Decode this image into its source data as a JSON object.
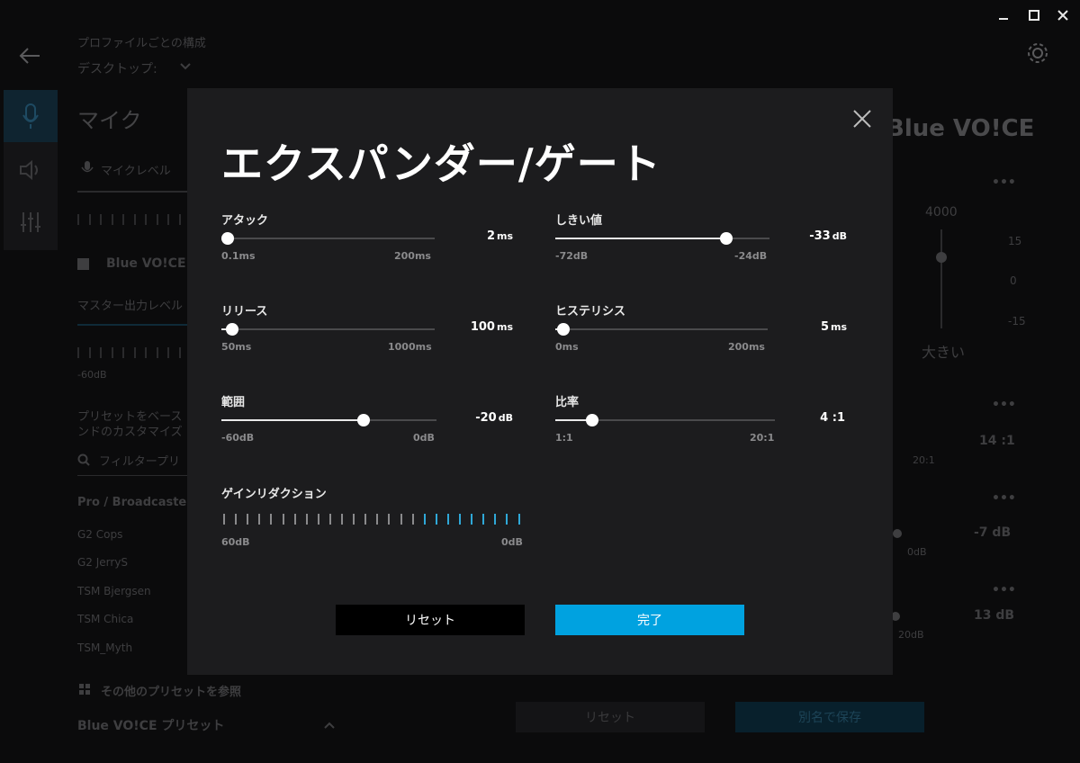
{
  "window": {
    "minimize_icon": "minimize-icon",
    "maximize_icon": "maximize-icon",
    "close_icon": "close-icon"
  },
  "background": {
    "header": {
      "title": "プロファイルごとの構成",
      "profile": "デスクトップ:"
    },
    "section_title": "マイク",
    "mic_level_tab": "マイクレベル",
    "blue_voice_logo": "Blue VO!CE",
    "blue_voice_label": "Blue VO!CE",
    "master_output": "マスター出力レベル",
    "meter_min": "-60dB",
    "preset_desc_line1": "プリセットをベース",
    "preset_desc_line2": "ンドのカスタマイズ",
    "filter_placeholder": "フィルタープリ",
    "preset_group": "Pro / Broadcaster",
    "presets": [
      "G2 Cops",
      "G2 JerryS",
      "TSM Bjergsen",
      "TSM Chica",
      "TSM_Myth"
    ],
    "browse_presets": "その他のプリセットを参照",
    "blue_presets": "Blue VO!CE プリセット",
    "eq_freq": "4000",
    "eq_db": [
      "15",
      "0",
      "-15"
    ],
    "eq_louder": "大きい",
    "right_values": [
      "14 :1",
      "-7 dB",
      "13 dB"
    ],
    "right_small": [
      "20:1",
      "0dB",
      "20dB"
    ],
    "reset_button": "リセット",
    "save_as_button": "別名で保存"
  },
  "modal": {
    "title": "エクスパンダー/ゲート",
    "sliders": [
      {
        "id": "attack",
        "label": "アタック",
        "value": "2",
        "unit": "ms",
        "min": "0.1ms",
        "max": "200ms",
        "position": 0.03
      },
      {
        "id": "threshold",
        "label": "しきい値",
        "value": "-33",
        "unit": "dB",
        "min": "-72dB",
        "max": "-24dB",
        "position": 0.8
      },
      {
        "id": "release",
        "label": "リリース",
        "value": "100",
        "unit": "ms",
        "min": "50ms",
        "max": "1000ms",
        "position": 0.05
      },
      {
        "id": "hysteresis",
        "label": "ヒステリシス",
        "value": "5",
        "unit": "ms",
        "min": "0ms",
        "max": "200ms",
        "position": 0.04
      },
      {
        "id": "range",
        "label": "範囲",
        "value": "-20",
        "unit": "dB",
        "min": "-60dB",
        "max": "0dB",
        "position": 0.66
      },
      {
        "id": "ratio",
        "label": "比率",
        "value": "4 :1",
        "unit": "",
        "min": "1:1",
        "max": "20:1",
        "position": 0.17
      }
    ],
    "gain_reduction": {
      "label": "ゲインリダクション",
      "min": "60dB",
      "max": "0dB",
      "tick_count": 26,
      "active_count": 9,
      "active_color": "#2fa8d8"
    },
    "reset_button": "リセット",
    "done_button": "完了",
    "accent_color": "#00a2e0"
  }
}
